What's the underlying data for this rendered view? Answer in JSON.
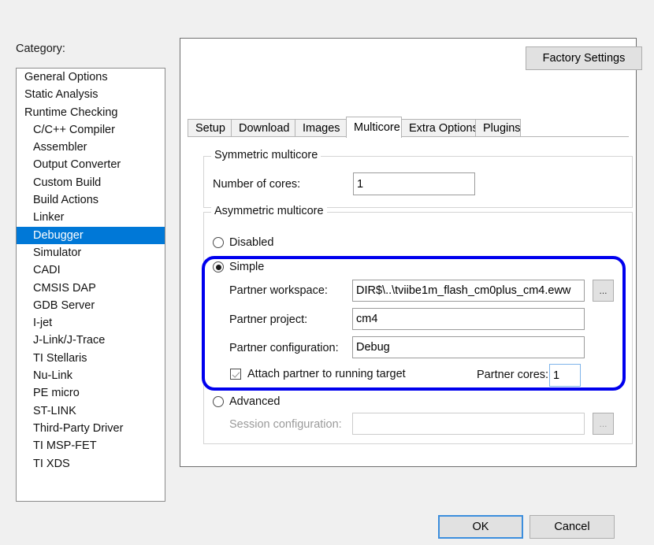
{
  "sidebar": {
    "label": "Category:",
    "items": [
      {
        "label": "General Options",
        "indent": false,
        "selected": false
      },
      {
        "label": "Static Analysis",
        "indent": false,
        "selected": false
      },
      {
        "label": "Runtime Checking",
        "indent": false,
        "selected": false
      },
      {
        "label": "C/C++ Compiler",
        "indent": true,
        "selected": false
      },
      {
        "label": "Assembler",
        "indent": true,
        "selected": false
      },
      {
        "label": "Output Converter",
        "indent": true,
        "selected": false
      },
      {
        "label": "Custom Build",
        "indent": true,
        "selected": false
      },
      {
        "label": "Build Actions",
        "indent": true,
        "selected": false
      },
      {
        "label": "Linker",
        "indent": true,
        "selected": false
      },
      {
        "label": "Debugger",
        "indent": true,
        "selected": true
      },
      {
        "label": "Simulator",
        "indent": true,
        "selected": false
      },
      {
        "label": "CADI",
        "indent": true,
        "selected": false
      },
      {
        "label": "CMSIS DAP",
        "indent": true,
        "selected": false
      },
      {
        "label": "GDB Server",
        "indent": true,
        "selected": false
      },
      {
        "label": "I-jet",
        "indent": true,
        "selected": false
      },
      {
        "label": "J-Link/J-Trace",
        "indent": true,
        "selected": false
      },
      {
        "label": "TI Stellaris",
        "indent": true,
        "selected": false
      },
      {
        "label": "Nu-Link",
        "indent": true,
        "selected": false
      },
      {
        "label": "PE micro",
        "indent": true,
        "selected": false
      },
      {
        "label": "ST-LINK",
        "indent": true,
        "selected": false
      },
      {
        "label": "Third-Party Driver",
        "indent": true,
        "selected": false
      },
      {
        "label": "TI MSP-FET",
        "indent": true,
        "selected": false
      },
      {
        "label": "TI XDS",
        "indent": true,
        "selected": false
      }
    ]
  },
  "toolbar": {
    "factory_settings_label": "Factory Settings"
  },
  "tabs": [
    {
      "label": "Setup",
      "active": false
    },
    {
      "label": "Download",
      "active": false
    },
    {
      "label": "Images",
      "active": false
    },
    {
      "label": "Multicore",
      "active": true
    },
    {
      "label": "Extra Options",
      "active": false
    },
    {
      "label": "Plugins",
      "active": false
    }
  ],
  "symmetric": {
    "group_title": "Symmetric multicore",
    "cores_label": "Number of cores:",
    "cores_value": "1"
  },
  "asymmetric": {
    "group_title": "Asymmetric multicore",
    "mode_disabled_label": "Disabled",
    "mode_simple_label": "Simple",
    "mode_advanced_label": "Advanced",
    "selected_mode": "Simple",
    "partner_workspace_label": "Partner workspace:",
    "partner_workspace_value": "DIR$\\..\\tviibe1m_flash_cm0plus_cm4.eww",
    "partner_project_label": "Partner project:",
    "partner_project_value": "cm4",
    "partner_configuration_label": "Partner configuration:",
    "partner_configuration_value": "Debug",
    "attach_partner_label": "Attach partner to running target",
    "attach_partner_checked": true,
    "partner_cores_label": "Partner cores:",
    "partner_cores_value": "1",
    "session_configuration_label": "Session configuration:",
    "session_configuration_value": "",
    "browse_button_label": "..."
  },
  "footer": {
    "ok_label": "OK",
    "cancel_label": "Cancel"
  },
  "annotation": {
    "highlight_color": "#0000ee"
  }
}
